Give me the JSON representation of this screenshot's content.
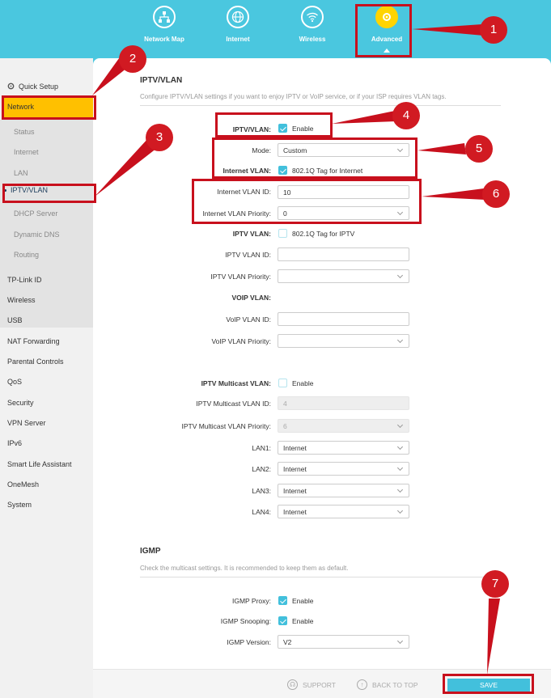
{
  "topnav": {
    "items": [
      {
        "label": "Network Map",
        "icon": "network-map-icon"
      },
      {
        "label": "Internet",
        "icon": "globe-icon"
      },
      {
        "label": "Wireless",
        "icon": "wifi-icon"
      },
      {
        "label": "Advanced",
        "icon": "gear-icon"
      }
    ]
  },
  "sidebar": {
    "quick_setup": "Quick Setup",
    "network": "Network",
    "network_sub": [
      "Status",
      "Internet",
      "LAN",
      "IPTV/VLAN",
      "DHCP Server",
      "Dynamic DNS",
      "Routing"
    ],
    "items": [
      "TP-Link ID",
      "Wireless",
      "USB",
      "NAT Forwarding",
      "Parental Controls",
      "QoS",
      "Security",
      "VPN Server",
      "IPv6",
      "Smart Life Assistant",
      "OneMesh",
      "System"
    ]
  },
  "iptv": {
    "title": "IPTV/VLAN",
    "description": "Configure IPTV/VLAN settings if you want to enjoy IPTV or VoIP service, or if your ISP requires VLAN tags.",
    "iptv_vlan_label": "IPTV/VLAN:",
    "iptv_vlan_enable": "Enable",
    "mode_label": "Mode:",
    "mode_value": "Custom",
    "internet_vlan_label": "Internet VLAN:",
    "internet_vlan_tag": "802.1Q Tag for Internet",
    "internet_vlan_id_label": "Internet VLAN ID:",
    "internet_vlan_id_value": "10",
    "internet_vlan_priority_label": "Internet VLAN Priority:",
    "internet_vlan_priority_value": "0",
    "iptv_vlan2_label": "IPTV VLAN:",
    "iptv_vlan_tag": "802.1Q Tag for IPTV",
    "iptv_vlan_id_label": "IPTV VLAN ID:",
    "iptv_vlan_priority_label": "IPTV VLAN Priority:",
    "voip_vlan_label": "VOIP VLAN:",
    "voip_vlan_id_label": "VoIP VLAN ID:",
    "voip_vlan_priority_label": "VoIP VLAN Priority:",
    "multicast_label": "IPTV Multicast VLAN:",
    "multicast_enable": "Enable",
    "multicast_id_label": "IPTV Multicast VLAN ID:",
    "multicast_id_value": "4",
    "multicast_priority_label": "IPTV Multicast VLAN Priority:",
    "multicast_priority_value": "6",
    "lan1_label": "LAN1:",
    "lan1_value": "Internet",
    "lan2_label": "LAN2:",
    "lan2_value": "Internet",
    "lan3_label": "LAN3:",
    "lan3_value": "Internet",
    "lan4_label": "LAN4:",
    "lan4_value": "Internet"
  },
  "igmp": {
    "title": "IGMP",
    "description": "Check the multicast settings. It is recommended to keep them as default.",
    "proxy_label": "IGMP Proxy:",
    "proxy_enable": "Enable",
    "snooping_label": "IGMP Snooping:",
    "snooping_enable": "Enable",
    "version_label": "IGMP Version:",
    "version_value": "V2"
  },
  "footer": {
    "support": "SUPPORT",
    "back_to_top": "BACK TO TOP",
    "save": "SAVE"
  },
  "callouts": [
    "1",
    "2",
    "3",
    "4",
    "5",
    "6",
    "7"
  ],
  "colors": {
    "header": "#4ac7df",
    "accent": "#42c0dc",
    "highlight": "#ffc000",
    "annotation": "#c8101d"
  }
}
